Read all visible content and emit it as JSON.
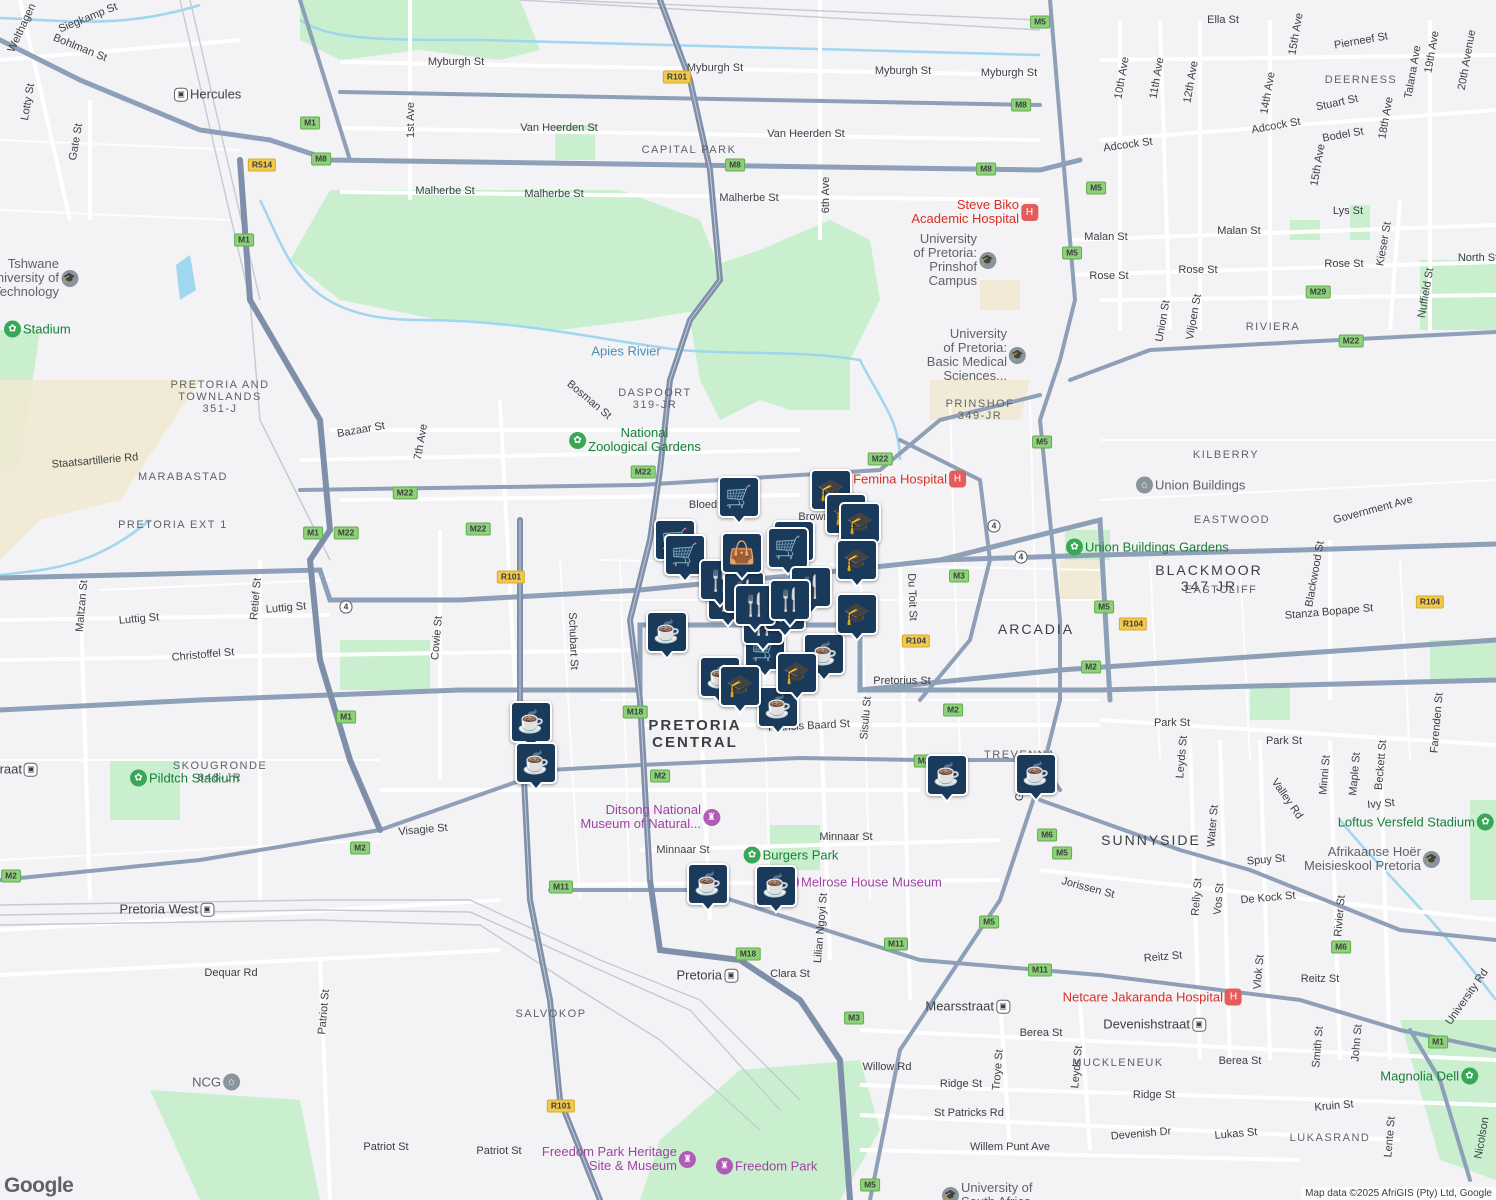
{
  "attribution": "Map data ©2025 AfriGIS (Pty) Ltd, Google",
  "logo": "Google",
  "area_labels": [
    {
      "text": "PRETORIA CENTRAL",
      "size": "big"
    },
    {
      "text": "ARCADIA",
      "size": "mid"
    },
    {
      "text": "SUNNYSIDE",
      "size": "mid"
    },
    {
      "text": "CAPITAL PARK",
      "size": "sm"
    },
    {
      "text": "DASPOORT 319-JR",
      "size": "sm"
    },
    {
      "text": "PRETORIA AND TOWNLANDS 351-J",
      "size": "sm"
    },
    {
      "text": "MARABASTAD",
      "size": "sm"
    },
    {
      "text": "PRETORIA EXT 1",
      "size": "sm"
    },
    {
      "text": "SKOUGRONDE 648-JR",
      "size": "sm"
    },
    {
      "text": "PRINSHOF 349-JR",
      "size": "sm"
    },
    {
      "text": "BLACKMOOR 347 JR",
      "size": "mid"
    },
    {
      "text": "KILBERRY",
      "size": "sm"
    },
    {
      "text": "EASTWOOD",
      "size": "sm"
    },
    {
      "text": "EASTCLIFF",
      "size": "sm"
    },
    {
      "text": "DEERNESS",
      "size": "sm"
    },
    {
      "text": "RIVIERA",
      "size": "sm"
    },
    {
      "text": "TREVENNA",
      "size": "sm"
    },
    {
      "text": "MUCKLENEUK",
      "size": "sm"
    },
    {
      "text": "LUKASRAND",
      "size": "sm"
    },
    {
      "text": "SALVOKOP",
      "size": "sm"
    }
  ],
  "street_labels": [
    "Siegkamp St",
    "Bohlman St",
    "Welthagen",
    "Lotty St",
    "Gate St",
    "Myburgh St",
    "Myburgh St",
    "Myburgh St",
    "Myburgh St",
    "Van Heerden St",
    "Van Heerden St",
    "Malherbe St",
    "Malherbe St",
    "Malherbe St",
    "1st Ave",
    "6th Ave",
    "Ella St",
    "10th Ave",
    "11th Ave",
    "12th Ave",
    "14th Ave",
    "15th Ave",
    "15th Ave",
    "Talana Ave",
    "19th Ave",
    "20th Avenue",
    "Pierneef St",
    "Stuart St",
    "Adcock St",
    "Adcock St",
    "Bodel St",
    "18th Ave",
    "Malan St",
    "Malan St",
    "Lys St",
    "Rose St",
    "Rose St",
    "Rose St",
    "Kieser St",
    "North St",
    "Union St",
    "Viljoen St",
    "Nuffield St",
    "Bosman St",
    "Bazaar St",
    "7th Ave",
    "Staatsartillerie Rd",
    "Blackwood St",
    "Government Ave",
    "Luttig St",
    "Luttig St",
    "Maltzan St",
    "Retief St",
    "Cowie St",
    "Schubart St",
    "Christoffel St",
    "Stanza Bopape St",
    "Du Toit St",
    "Pretorius St",
    "Sisulu St",
    "Francis Baard St",
    "Park St",
    "Park St",
    "Leyds St",
    "Minni St",
    "Maple St",
    "Ivy St",
    "Beckett St",
    "Farenden St",
    "Valley Rd",
    "Visagie St",
    "Minnaar St",
    "Minnaar St",
    "Spuy St",
    "De Kock St",
    "Jorissen St",
    "Water St",
    "Relly St",
    "Vos St",
    "Rivier St",
    "Reitz St",
    "Reitz St",
    "Lilian Ngoyi St",
    "Clara St",
    "Dequar Rd",
    "Patriot St",
    "Patriot St",
    "Patriot St",
    "Berea St",
    "Berea St",
    "Ridge St",
    "Ridge St",
    "St Patricks Rd",
    "Willow Rd",
    "Willem Punt Ave",
    "Devenish Dr",
    "Lukas St",
    "Kruin St",
    "Vlok St",
    "Smith St",
    "John St",
    "Lente St",
    "University Rd",
    "Nicolson",
    "Troye St",
    "Leyds St",
    "Gr",
    "Brown",
    "Bloed"
  ],
  "pois": [
    {
      "name": "Hercules",
      "type": "rail"
    },
    {
      "name": "Tshwane University of Technology",
      "type": "edu"
    },
    {
      "name": "Stadium",
      "type": "park"
    },
    {
      "name": "Apies Rivier",
      "type": "water"
    },
    {
      "name": "National Zoological Gardens",
      "type": "park"
    },
    {
      "name": "Steve Biko Academic Hospital",
      "type": "med"
    },
    {
      "name": "University of Pretoria: Prinshof Campus",
      "type": "edu"
    },
    {
      "name": "University of Pretoria: Basic Medical Sciences...",
      "type": "edu"
    },
    {
      "name": "Femina Hospital",
      "type": "med"
    },
    {
      "name": "Union Buildings",
      "type": "gov"
    },
    {
      "name": "Union Buildings Gardens",
      "type": "park"
    },
    {
      "name": "Pildtch Stadium",
      "type": "park"
    },
    {
      "name": "Ditsong National Museum of Natural...",
      "type": "mus"
    },
    {
      "name": "Burgers Park",
      "type": "park"
    },
    {
      "name": "Melrose House Museum",
      "type": "mus"
    },
    {
      "name": "Pretoria West",
      "type": "rail"
    },
    {
      "name": "Pretoria",
      "type": "rail"
    },
    {
      "name": "Mearsstraat",
      "type": "rail"
    },
    {
      "name": "Devenishstraat",
      "type": "rail"
    },
    {
      "name": "Netcare Jakaranda Hospital",
      "type": "med"
    },
    {
      "name": "Loftus Versfeld Stadium",
      "type": "park"
    },
    {
      "name": "Afrikaanse Hoër Meisieskool Pretoria",
      "type": "edu"
    },
    {
      "name": "Magnolia Dell",
      "type": "park"
    },
    {
      "name": "NCG",
      "type": "gov"
    },
    {
      "name": "Freedom Park Heritage Site & Museum",
      "type": "mus"
    },
    {
      "name": "Freedom Park",
      "type": "mus"
    },
    {
      "name": "University of South Africa",
      "type": "edu"
    },
    {
      "name": "raat",
      "type": "rail"
    }
  ],
  "shields": [
    "M5",
    "R101",
    "M8",
    "M8",
    "M8",
    "M1",
    "R514",
    "M1",
    "M5",
    "M5",
    "M29",
    "M22",
    "M22",
    "M5",
    "M22",
    "M22",
    "M22",
    "M1",
    "M22",
    "R101",
    "4",
    "4",
    "4",
    "M3",
    "M5",
    "R104",
    "R104",
    "R104",
    "M2",
    "M1",
    "M18",
    "M2",
    "M2",
    "M2",
    "M6",
    "M5",
    "M11",
    "M18",
    "M11",
    "M5",
    "M3",
    "R101",
    "M5",
    "M11",
    "M6",
    "M2",
    "M22",
    "M8",
    "M1"
  ],
  "markers": [
    {
      "kind": "cafe",
      "icon": "cup-icon"
    },
    {
      "kind": "cafe",
      "icon": "cup-icon"
    },
    {
      "kind": "cafe",
      "icon": "cup-icon"
    },
    {
      "kind": "cafe",
      "icon": "cup-icon"
    },
    {
      "kind": "cafe",
      "icon": "cup-icon"
    },
    {
      "kind": "cafe",
      "icon": "cup-icon"
    },
    {
      "kind": "cafe",
      "icon": "cup-icon"
    },
    {
      "kind": "cafe",
      "icon": "cup-icon"
    },
    {
      "kind": "cafe",
      "icon": "cup-icon"
    },
    {
      "kind": "cafe",
      "icon": "cup-icon"
    },
    {
      "kind": "shop",
      "icon": "cart-icon"
    },
    {
      "kind": "shop",
      "icon": "cart-icon"
    },
    {
      "kind": "shop",
      "icon": "cart-icon"
    },
    {
      "kind": "shop",
      "icon": "cart-icon"
    },
    {
      "kind": "shop",
      "icon": "cart-icon"
    },
    {
      "kind": "shop",
      "icon": "cart-icon"
    },
    {
      "kind": "school",
      "icon": "graduation-cap-icon"
    },
    {
      "kind": "school",
      "icon": "graduation-cap-icon"
    },
    {
      "kind": "school",
      "icon": "graduation-cap-icon"
    },
    {
      "kind": "school",
      "icon": "graduation-cap-icon"
    },
    {
      "kind": "school",
      "icon": "graduation-cap-icon"
    },
    {
      "kind": "school",
      "icon": "graduation-cap-icon"
    },
    {
      "kind": "school",
      "icon": "graduation-cap-icon"
    },
    {
      "kind": "restaurant",
      "icon": "fork-knife-icon"
    },
    {
      "kind": "restaurant",
      "icon": "fork-knife-icon"
    },
    {
      "kind": "restaurant",
      "icon": "fork-knife-icon"
    },
    {
      "kind": "restaurant",
      "icon": "fork-knife-icon"
    },
    {
      "kind": "restaurant",
      "icon": "fork-knife-icon"
    },
    {
      "kind": "restaurant",
      "icon": "fork-knife-icon"
    },
    {
      "kind": "restaurant",
      "icon": "fork-knife-icon"
    },
    {
      "kind": "restaurant",
      "icon": "fork-knife-icon"
    },
    {
      "kind": "shop",
      "icon": "bag-icon"
    }
  ],
  "colors": {
    "land": "#f3f2f5",
    "park": "#c9efcf",
    "water": "#9fd6f0",
    "road": "#ffffff",
    "arterial": "#8e9fb8",
    "highway": "#7f8fa9",
    "marker": "#1a3a5c",
    "urban": "#f1e9d3"
  }
}
